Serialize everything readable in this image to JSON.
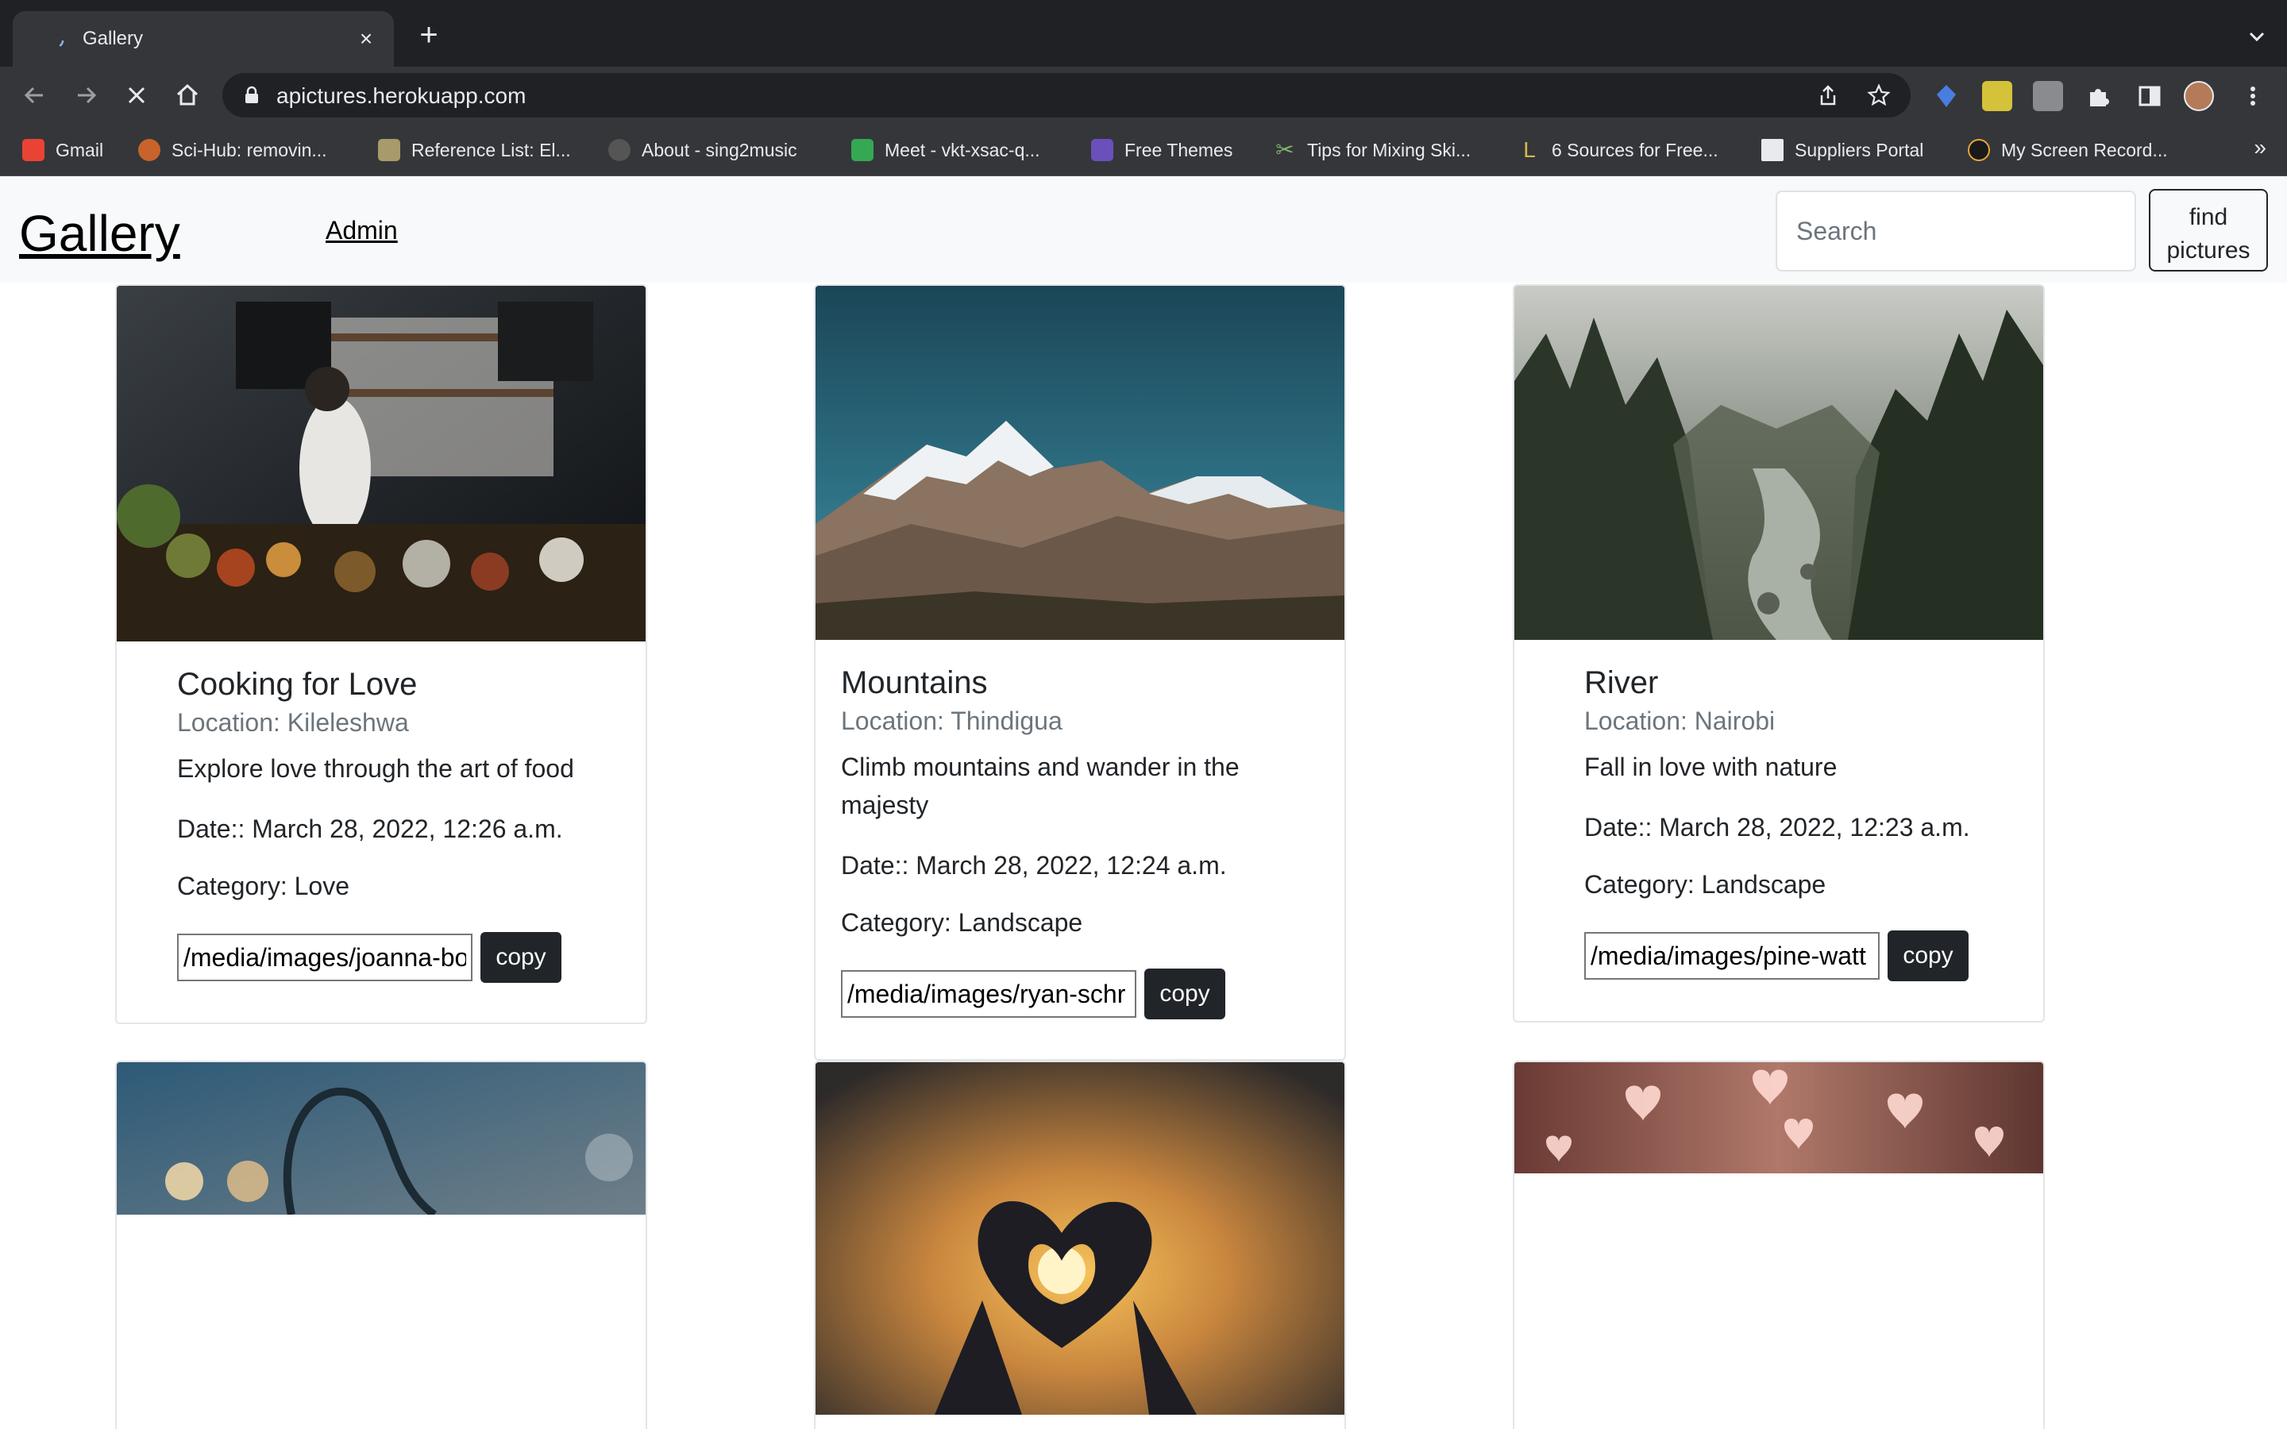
{
  "browser": {
    "tab_title": "Gallery",
    "url": "apictures.herokuapp.com",
    "bookmarks": [
      {
        "label": "Gmail",
        "icon": "gmail-icon"
      },
      {
        "label": "Sci-Hub: removin...",
        "icon": "scihub-icon"
      },
      {
        "label": "Reference List: El...",
        "icon": "purdue-icon"
      },
      {
        "label": "About - sing2music",
        "icon": "sing2music-icon"
      },
      {
        "label": "Meet - vkt-xsac-q...",
        "icon": "meet-icon"
      },
      {
        "label": "Free Themes",
        "icon": "colorlib-icon"
      },
      {
        "label": "Tips for Mixing Ski...",
        "icon": "scissors-icon"
      },
      {
        "label": "6 Sources for Free...",
        "icon": "l-icon"
      },
      {
        "label": "Suppliers Portal",
        "icon": "document-icon"
      },
      {
        "label": "My Screen Record...",
        "icon": "recorder-icon"
      }
    ],
    "more_bookmarks": "»"
  },
  "navbar": {
    "brand": "Gallery",
    "admin_link": "Admin",
    "search_placeholder": "Search",
    "find_button_line1": "find",
    "find_button_line2": "pictures"
  },
  "cards": [
    {
      "title": "Cooking for Love",
      "location": "Location: Kileleshwa",
      "description": "Explore love through the art of food",
      "date": "Date:: March 28, 2022, 12:26 a.m.",
      "category": "Category: Love",
      "path": "/media/images/joanna-bo",
      "copy_label": "copy"
    },
    {
      "title": "Mountains",
      "location": "Location: Thindigua",
      "description": "Climb mountains and wander in the majesty",
      "date": "Date:: March 28, 2022, 12:24 a.m.",
      "category": "Category: Landscape",
      "path": "/media/images/ryan-schr",
      "copy_label": "copy"
    },
    {
      "title": "River",
      "location": "Location: Nairobi",
      "description": "Fall in love with nature",
      "date": "Date:: March 28, 2022, 12:23 a.m.",
      "category": "Category: Landscape",
      "path": "/media/images/pine-watt",
      "copy_label": "copy"
    }
  ],
  "colors": {
    "chrome_dark": "#202124",
    "chrome_toolbar": "#35363a",
    "navbar_bg": "#f8f9fa",
    "button_dark": "#212529",
    "muted_text": "#6c757d"
  }
}
